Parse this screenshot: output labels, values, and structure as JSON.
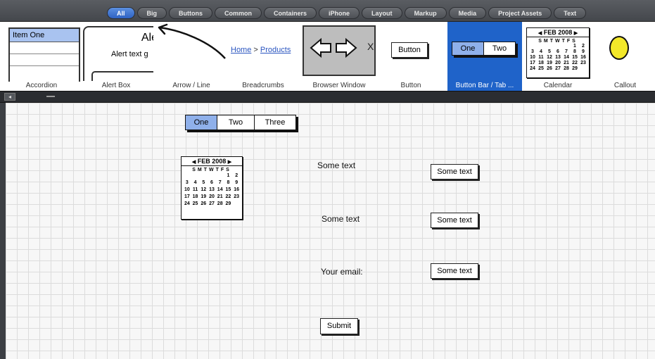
{
  "categories": {
    "tabs": [
      "All",
      "Big",
      "Buttons",
      "Common",
      "Containers",
      "iPhone",
      "Layout",
      "Markup",
      "Media",
      "Project Assets",
      "Text"
    ],
    "active": "All"
  },
  "library": {
    "accordion": {
      "item_one": "Item One",
      "label": "Accordion"
    },
    "alert_box": {
      "title": "Ale",
      "text": "Alert text g",
      "label": "Alert Box"
    },
    "arrow_line": {
      "label": "Arrow / Line"
    },
    "breadcrumbs": {
      "home": "Home",
      "separator": ">",
      "products": "Products",
      "label": "Breadcrumbs"
    },
    "browser_window": {
      "label": "Browser Window",
      "close_glyph": "X"
    },
    "button": {
      "text": "Button",
      "label": "Button"
    },
    "button_bar": {
      "seg1": "One",
      "seg2": "Two",
      "label": "Button Bar / Tab ..."
    },
    "calendar": {
      "label": "Calendar"
    },
    "callout": {
      "label": "Callout"
    }
  },
  "calendar_widget": {
    "header": "FEB 2008",
    "prev_arrow": "◀",
    "next_arrow": "▶",
    "weekdays": "SMTWTFS",
    "days": [
      "",
      "",
      "",
      "",
      "",
      "1",
      "2",
      "3",
      "4",
      "5",
      "6",
      "7",
      "8",
      "9",
      "10",
      "11",
      "12",
      "13",
      "14",
      "15",
      "16",
      "17",
      "18",
      "19",
      "20",
      "21",
      "22",
      "23",
      "24",
      "25",
      "26",
      "27",
      "28",
      "29"
    ]
  },
  "separator": {
    "collapse_glyph": "◂"
  },
  "canvas": {
    "tabbar": {
      "seg1": "One",
      "seg2": "Two",
      "seg3": "Three",
      "selected": "One"
    },
    "text1": "Some text",
    "text2": "Some text",
    "email_label": "Your email:",
    "input1": "Some text",
    "input2": "Some text",
    "input3": "Some text",
    "submit": "Submit"
  },
  "colors": {
    "selected_blue": "#1f63c9",
    "selected_segment": "#8fb0ea",
    "callout_yellow": "#f3e82a",
    "browser_gray": "#bdbdbd"
  }
}
